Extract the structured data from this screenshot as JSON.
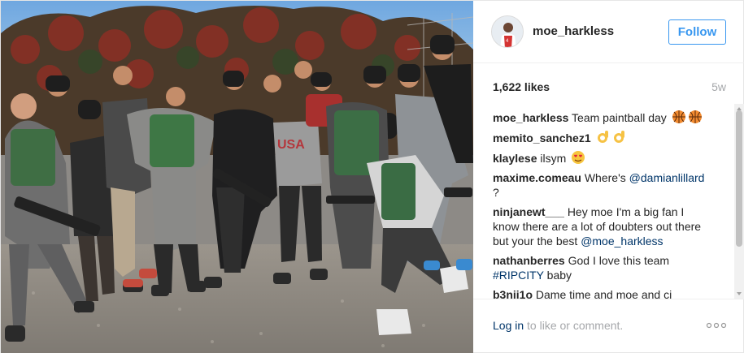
{
  "post": {
    "photo_alt": "Team paintball day group photo",
    "header": {
      "username": "moe_harkless",
      "follow_label": "Follow"
    },
    "stats": {
      "likes": "1,622 likes",
      "time": "5w"
    },
    "comments": [
      {
        "author": "moe_harkless",
        "text": "Team paintball day",
        "emoji": "basketball",
        "emoji_count": 2
      },
      {
        "author": "memito_sanchez1",
        "text": "",
        "emoji": "ok-hand",
        "emoji_count": 2
      },
      {
        "author": "klaylese",
        "text": "ilsym",
        "emoji": "heart-eyes",
        "emoji_count": 1
      },
      {
        "author": "maxime.comeau",
        "text": "Where's",
        "mention": "@damianlillard",
        "after": "?"
      },
      {
        "author": "ninjanewt___",
        "text": "Hey moe I'm a big fan I know there are a lot of doubters out there but your the best",
        "mention": "@moe_harkless",
        "after": ""
      },
      {
        "author": "nathanberres",
        "text": "God I love this team",
        "mention": "#RIPCITY",
        "after": "baby"
      },
      {
        "author": "b3nji1o",
        "text": "Dame time and moe and ci",
        "mention": "",
        "after": ""
      }
    ],
    "footer": {
      "login_label": "Log in",
      "login_rest": " to like or comment.",
      "more_icon": "ellipsis-icon"
    },
    "colors": {
      "link": "#003569",
      "follow": "#3897f0",
      "muted": "#a5a7aa",
      "text": "#262626"
    }
  }
}
